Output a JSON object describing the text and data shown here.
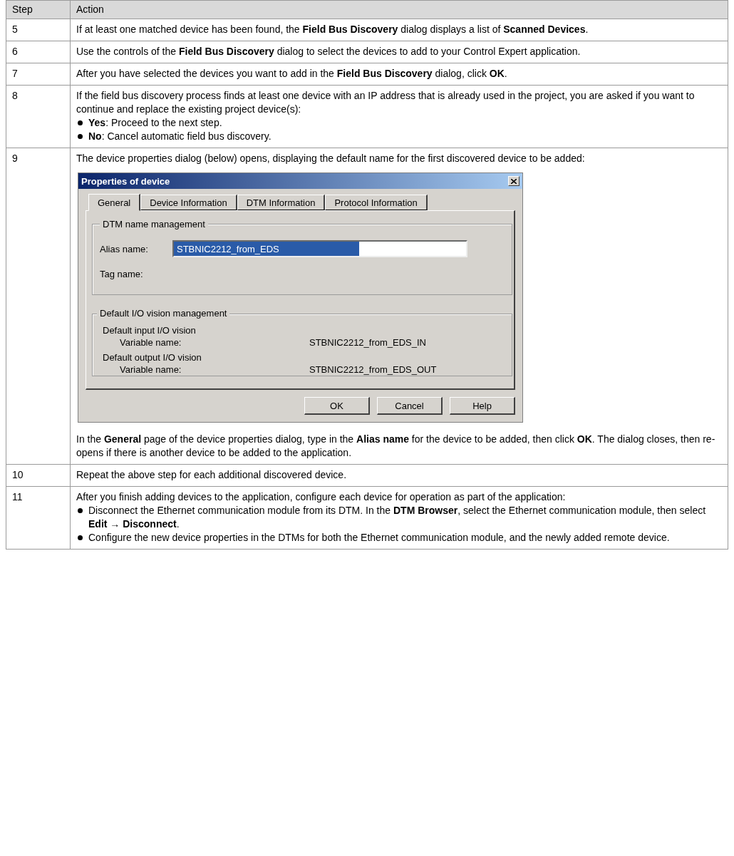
{
  "table": {
    "columns": [
      "Step",
      "Action"
    ],
    "rows": [
      {
        "step": "5",
        "content": [
          {
            "kind": "paragraph",
            "text": "If at least one matched device has been found, the **Field Bus Discovery** dialog displays a list of **Scanned Devices**."
          }
        ]
      },
      {
        "step": "6",
        "content": [
          {
            "kind": "paragraph",
            "text": "Use the controls of the **Field Bus Discovery** dialog to select the devices to add to your Control Expert application."
          }
        ]
      },
      {
        "step": "7",
        "content": [
          {
            "kind": "paragraph",
            "text": "After you have selected the devices you want to add in the **Field Bus Discovery** dialog, click **OK**."
          }
        ]
      },
      {
        "step": "8",
        "content": [
          {
            "kind": "paragraph",
            "text": "If the field bus discovery process finds at least one device with an IP address that is already used in the project, you are asked if you want to continue and replace the existing project device(s):"
          },
          {
            "kind": "bullets",
            "items": [
              "**Yes**: Proceed to the next step.",
              "**No**: Cancel automatic field bus discovery."
            ]
          }
        ]
      },
      {
        "step": "9",
        "content": [
          {
            "kind": "paragraph",
            "text": "The device properties dialog (below) opens, displaying the default name for the first discovered device to be added:"
          },
          {
            "kind": "dialog",
            "title": "Properties of device",
            "tabs": [
              {
                "label": "General",
                "selected": true
              },
              {
                "label": "Device Information",
                "selected": false
              },
              {
                "label": "DTM Information",
                "selected": false
              },
              {
                "label": "Protocol Information",
                "selected": false
              }
            ],
            "name_group": {
              "title": "DTM name management",
              "alias_label": "Alias name:",
              "alias_value": "STBNIC2212_from_EDS",
              "alias_selected": true,
              "tag_label": "Tag name:"
            },
            "vision_group": {
              "title": "Default I/O vision management",
              "entries": [
                {
                  "heading": "Default input I/O vision",
                  "label": "Variable name:",
                  "value": "STBNIC2212_from_EDS_IN"
                },
                {
                  "heading": "Default output I/O vision",
                  "label": "Variable name:",
                  "value": "STBNIC2212_from_EDS_OUT"
                }
              ]
            },
            "buttons": [
              "OK",
              "Cancel",
              "Help"
            ]
          },
          {
            "kind": "paragraph",
            "text": "In the **General** page of the device properties dialog, type in the **Alias name** for the device to be added, then click **OK**. The dialog closes, then re-opens if there is another device to be added to the application."
          }
        ]
      },
      {
        "step": "10",
        "content": [
          {
            "kind": "paragraph",
            "text": "Repeat the above step for each additional discovered device."
          }
        ]
      },
      {
        "step": "11",
        "content": [
          {
            "kind": "paragraph",
            "text": "After you finish adding devices to the application, configure each device for operation as part of the application:"
          },
          {
            "kind": "bullets",
            "items": [
              "Disconnect the Ethernet communication module from its DTM. In the **DTM Browser**, select the Ethernet communication module, then select **Edit → Disconnect**.",
              "Configure the new device properties in the DTMs for both the Ethernet communication module, and the newly added remote device."
            ]
          }
        ]
      }
    ]
  }
}
